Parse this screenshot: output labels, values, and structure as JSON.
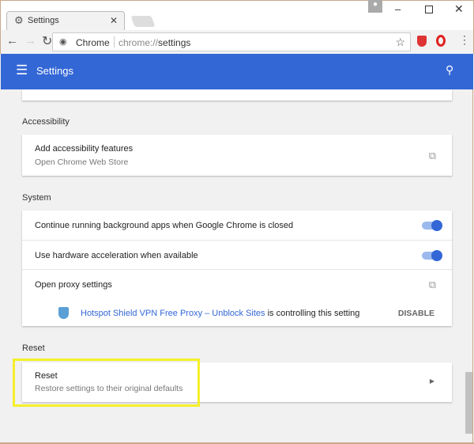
{
  "browser": {
    "tab_title": "Settings",
    "omnibox_site": "Chrome",
    "omnibox_url_prefix": "chrome://",
    "omnibox_url_path": "settings"
  },
  "header": {
    "title": "Settings",
    "accent": "#3367d6"
  },
  "sections": {
    "accessibility": {
      "label": "Accessibility",
      "item_title": "Add accessibility features",
      "item_sub": "Open Chrome Web Store"
    },
    "system": {
      "label": "System",
      "bg_apps": {
        "label": "Continue running background apps when Google Chrome is closed",
        "enabled": true
      },
      "hw_accel": {
        "label": "Use hardware acceleration when available",
        "enabled": true
      },
      "proxy": {
        "label": "Open proxy settings"
      },
      "extension": {
        "link": "Hotspot Shield VPN Free Proxy – Unblock Sites",
        "text": " is controlling this setting",
        "action": "DISABLE"
      }
    },
    "reset": {
      "label": "Reset",
      "item_title": "Reset",
      "item_sub": "Restore settings to their original defaults"
    }
  },
  "highlight_color": "#f5ef2a"
}
